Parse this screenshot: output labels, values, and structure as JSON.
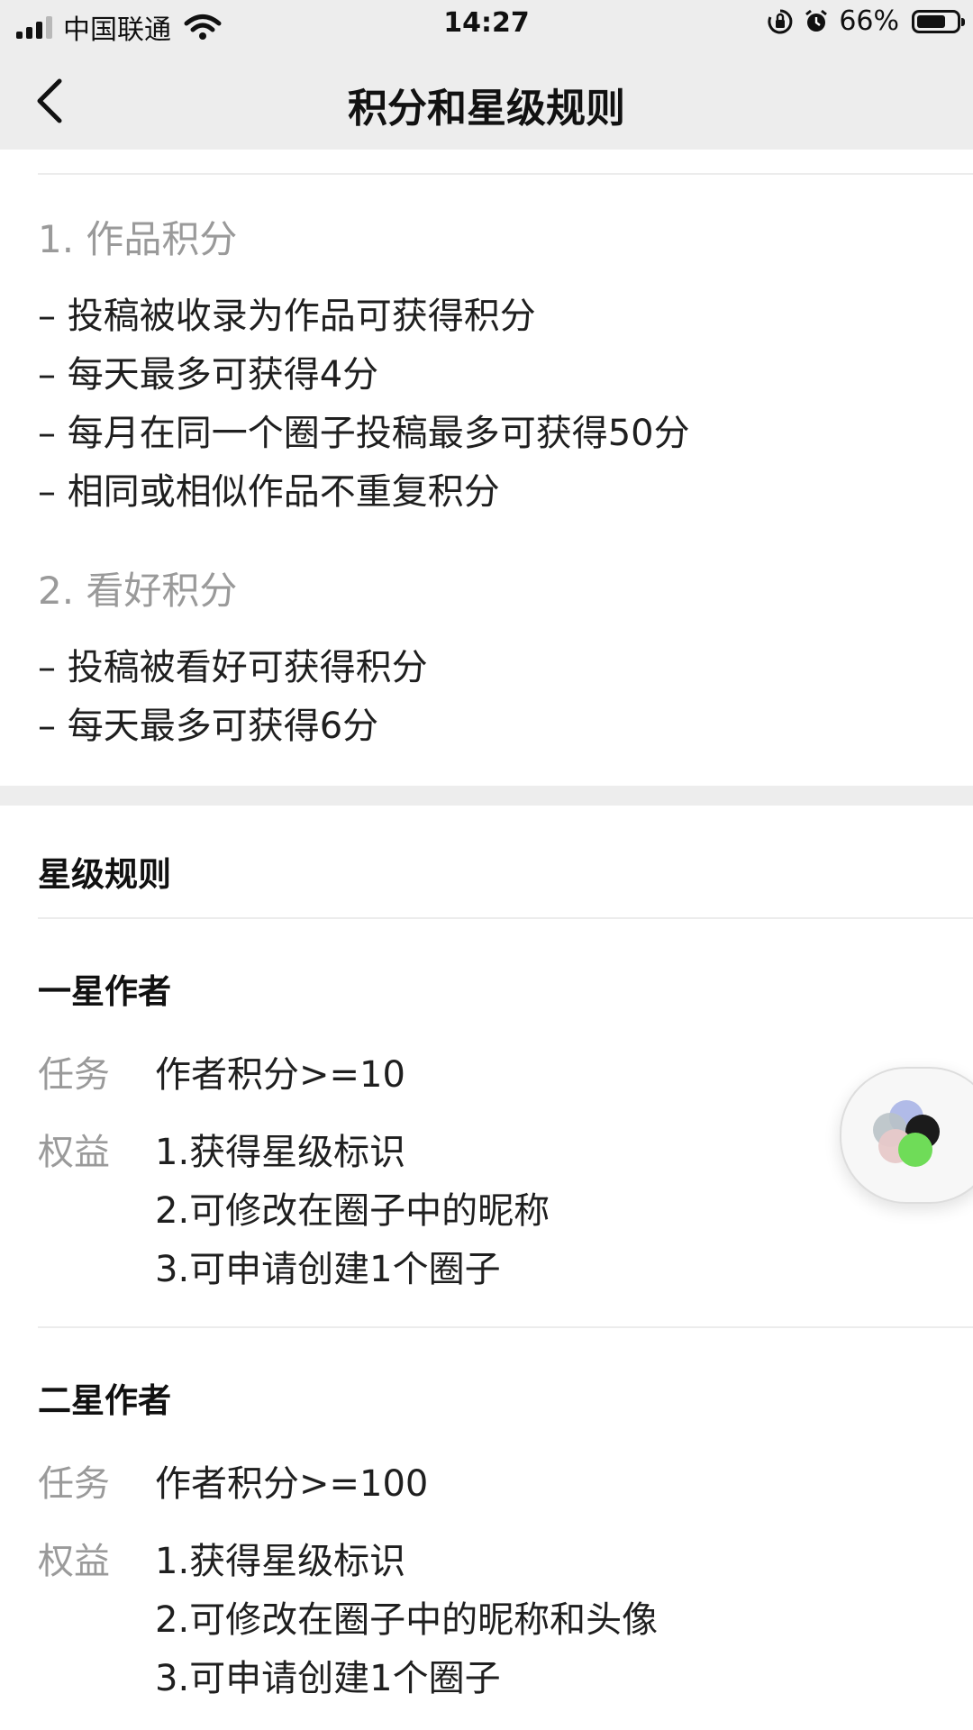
{
  "status_bar": {
    "carrier": "中国联通",
    "time": "14:27",
    "battery": "66%"
  },
  "nav": {
    "title": "积分和星级规则",
    "back_icon": "chevron-left-icon"
  },
  "points": {
    "section1": {
      "title": "1. 作品积分",
      "items": [
        "– 投稿被收录为作品可获得积分",
        "– 每天最多可获得4分",
        "– 每月在同一个圈子投稿最多可获得50分",
        "– 相同或相似作品不重复积分"
      ]
    },
    "section2": {
      "title": "2. 看好积分",
      "items": [
        "– 投稿被看好可获得积分",
        "– 每天最多可获得6分"
      ]
    }
  },
  "star_rules": {
    "title": "星级规则",
    "levels": [
      {
        "name": "一星作者",
        "task_label": "任务",
        "task": "作者积分>=10",
        "benefit_label": "权益",
        "benefits": [
          "1.获得星级标识",
          "2.可修改在圈子中的昵称",
          "3.可申请创建1个圈子"
        ]
      },
      {
        "name": "二星作者",
        "task_label": "任务",
        "task": "作者积分>=100",
        "benefit_label": "权益",
        "benefits": [
          "1.获得星级标识",
          "2.可修改在圈子中的昵称和头像",
          "3.可申请创建1个圈子"
        ]
      }
    ]
  },
  "floating_widget": {
    "icon": "floating-window-icon"
  }
}
